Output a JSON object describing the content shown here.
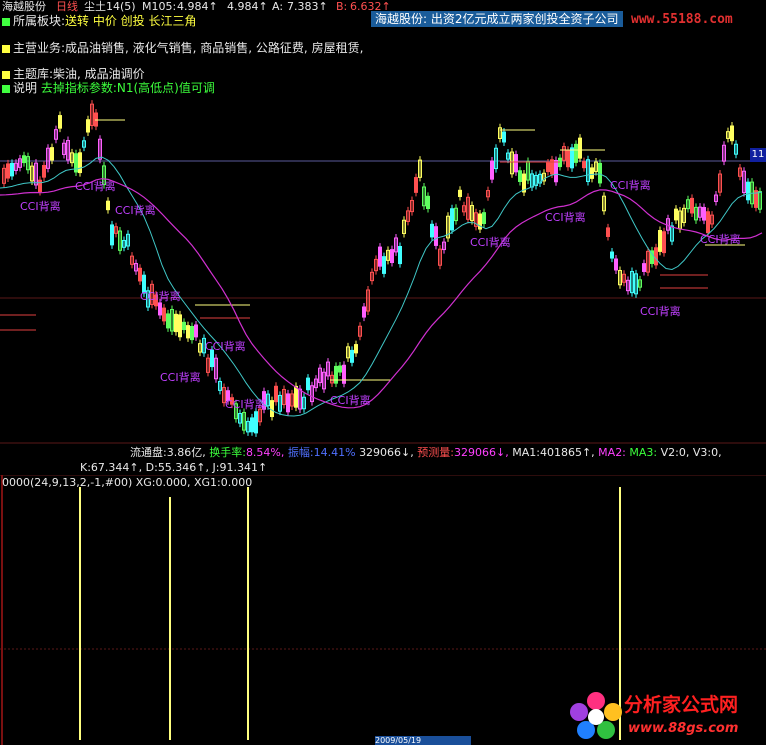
{
  "header": {
    "stock_name": "海越股份",
    "period": "日线",
    "indicator_name": "尘土14(5)",
    "m105_label": "M105:",
    "m105_value": "4.984↑",
    "m105_value2": "4.984↑",
    "a_label": "A:",
    "a_value": "7.383↑",
    "b_label": "B:",
    "b_value": "6.632↑"
  },
  "ticker": {
    "text": "海越股份: 出资2亿元成立两家创投全资子公司"
  },
  "watermark": {
    "text": "www.55188.com"
  },
  "info": {
    "sector_label": "所属板块:",
    "sector_value": "送转 中价 创投 长江三角",
    "business_label": "主营业务:",
    "business_value": "成品油销售, 液化气销售, 商品销售, 公路征费, 房屋租赁,",
    "theme_label": "主题库:",
    "theme_value": "柴油, 成品油调价",
    "note_label": "说明",
    "note_value": "去掉指标参数:N1(高低点)值可调"
  },
  "chart_annotations": {
    "cci_label": "CCI背离",
    "price_tag": "11"
  },
  "status_bar": {
    "float_label": "流通盘:",
    "float_value": "3.86亿,",
    "turnover_label": "换手率:",
    "turnover_value": "8.54%,",
    "amplitude_label": "振幅:",
    "amplitude_value": "14.41%",
    "volume_value": "329066↓,",
    "forecast_label": "预测量:",
    "forecast_value": "329066↓,",
    "ma1_label": "MA1:",
    "ma1_value": "401865↑,",
    "ma2_label": "MA2:",
    "ma3_label": "MA3:",
    "v2_label": "V2:",
    "v2_value": "0,",
    "v3_label": "V3:",
    "v3_value": "0,"
  },
  "kdj": {
    "k_label": "K:",
    "k_value": "67.344↑,",
    "d_label": "D:",
    "d_value": "55.346↑,",
    "j_label": "J:",
    "j_value": "91.341↑"
  },
  "lower": {
    "params": "0000(24,9,13,2,-1,#00)",
    "xg_label": "XG:",
    "xg_value": "0.000,",
    "xg1_label": "XG1:",
    "xg1_value": "0.000"
  },
  "logo": {
    "name": "分析家公式网",
    "url": "www.88gs.com"
  },
  "date_badge": {
    "text": "2009/05/19"
  },
  "colors": {
    "background": "#000000",
    "up": "#ff5050",
    "down": "#40ffff",
    "ma_cyan": "#40c8c8",
    "ma_magenta": "#d030d0",
    "signal": "#ffff80"
  }
}
